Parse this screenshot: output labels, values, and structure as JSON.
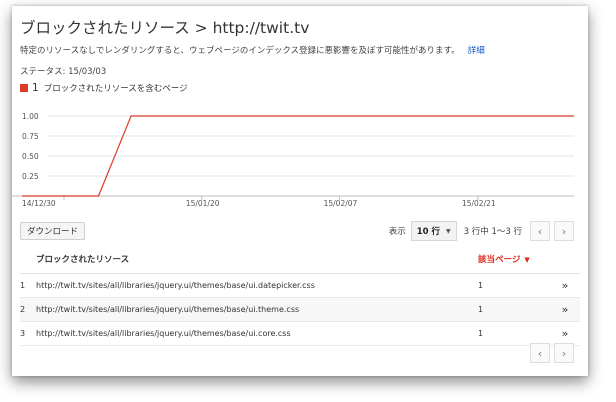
{
  "header": {
    "title": "ブロックされたリソース > http://twit.tv",
    "description": "特定のリソースなしでレンダリングすると、ウェブページのインデックス登録に悪影響を及ぼす可能性があります。",
    "details_link": "詳細",
    "status": "ステータス: 15/03/03"
  },
  "legend": {
    "count": "1",
    "label": "ブロックされたリソースを含むページ",
    "color": "#dd3a2a"
  },
  "chart_data": {
    "type": "line",
    "x_labels": [
      "14/12/30",
      "15/01/20",
      "15/02/07",
      "15/02/21"
    ],
    "y_ticks": [
      "1.00",
      "0.75",
      "0.50",
      "0.25"
    ],
    "ylim": [
      0,
      1
    ],
    "points": [
      {
        "x": 0.0,
        "y": 0
      },
      {
        "x": 0.096,
        "y": 0
      },
      {
        "x": 0.158,
        "y": 1
      },
      {
        "x": 1.0,
        "y": 1
      }
    ],
    "series_color": "#dd3a2a"
  },
  "toolbar": {
    "download_label": "ダウンロード",
    "show_label": "表示",
    "rows_value": "10 行",
    "range_label": "3 行中 1〜3 行",
    "prev_icon": "‹",
    "next_icon": "›"
  },
  "table": {
    "headers": {
      "resource": "ブロックされたリソース",
      "pages": "該当ページ",
      "sort_icon": "▼"
    },
    "rows": [
      {
        "index": "1",
        "url": "http://twit.tv/sites/all/libraries/jquery.ui/themes/base/ui.datepicker.css",
        "pages": "1",
        "action_icon": "»"
      },
      {
        "index": "2",
        "url": "http://twit.tv/sites/all/libraries/jquery.ui/themes/base/ui.theme.css",
        "pages": "1",
        "action_icon": "»"
      },
      {
        "index": "3",
        "url": "http://twit.tv/sites/all/libraries/jquery.ui/themes/base/ui.core.css",
        "pages": "1",
        "action_icon": "»"
      }
    ]
  }
}
